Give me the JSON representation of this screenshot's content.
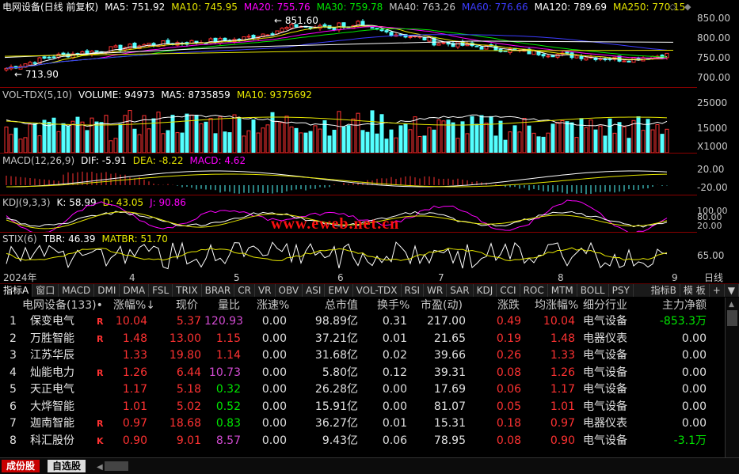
{
  "kline_header": {
    "title": "电网设备(日线 前复权)",
    "ma5": "MA5: 751.92",
    "ma10": "MA10: 745.95",
    "ma20": "MA20: 755.76",
    "ma30": "MA30: 759.78",
    "ma40": "MA40: 763.26",
    "ma60": "MA60: 776.66",
    "ma120": "MA120: 789.69",
    "ma250": "MA250: 770.15",
    "high_label": "851.60",
    "low_label": "713.90"
  },
  "kline_axis": [
    "850.00",
    "800.00",
    "750.00",
    "700.00"
  ],
  "vol_header": {
    "name": "VOL-TDX(5,10)",
    "volume": "VOLUME: 94973",
    "ma5": "MA5: 8735859",
    "ma10": "MA10: 9375692"
  },
  "vol_axis": [
    "25000",
    "15000",
    "X1000"
  ],
  "macd_header": {
    "name": "MACD(12,26,9)",
    "dif": "DIF: -5.91",
    "dea": "DEA: -8.22",
    "macd": "MACD: 4.62"
  },
  "macd_axis": [
    "20.00",
    "-20.00"
  ],
  "kdj_header": {
    "name": "KDJ(9,3,3)",
    "k": "K: 58.99",
    "d": "D: 43.05",
    "j": "J: 90.86"
  },
  "kdj_axis": [
    "100.00",
    "80.00",
    "20.00"
  ],
  "stix_header": {
    "name": "STIX(6)",
    "tbr": "TBR: 46.39",
    "matbr": "MATBR: 51.70"
  },
  "stix_axis": [
    "65.00"
  ],
  "watermark": "www.eweb.net.cn",
  "time_axis": {
    "year": "2024年",
    "months": [
      "4",
      "5",
      "6",
      "7",
      "8",
      "9"
    ],
    "period": "日线"
  },
  "indicator_tabs": [
    "指标A",
    "窗口",
    "MACD",
    "DMI",
    "DMA",
    "FSL",
    "TRIX",
    "BRAR",
    "CR",
    "VR",
    "OBV",
    "ASI",
    "EMV",
    "VOL-TDX",
    "RSI",
    "WR",
    "SAR",
    "KDJ",
    "CCI",
    "ROC",
    "MTM",
    "BOLL",
    "PSY"
  ],
  "indicator_b": "指标B",
  "template": "模 板",
  "table": {
    "headers": [
      "电网设备(133)•",
      "涨幅%↓",
      "现价",
      "量比",
      "涨速%",
      "总市值",
      "换手%",
      "市盈(动)",
      "涨跌",
      "均涨幅%",
      "细分行业",
      "主力净额"
    ],
    "rows": [
      {
        "no": "1",
        "name": "保变电气",
        "flag": "R",
        "chg": "10.04",
        "price": "5.37",
        "vr": "120.93",
        "spd": "0.00",
        "cap": "98.89亿",
        "turn": "0.31",
        "pe": "217.00",
        "diff": "0.49",
        "avg": "10.04",
        "ind": "电气设备",
        "net": "-853.3万"
      },
      {
        "no": "2",
        "name": "万胜智能",
        "flag": "R",
        "chg": "1.48",
        "price": "13.00",
        "vr": "1.15",
        "spd": "0.00",
        "cap": "37.21亿",
        "turn": "0.01",
        "pe": "21.65",
        "diff": "0.19",
        "avg": "1.48",
        "ind": "电器仪表",
        "net": "0.00"
      },
      {
        "no": "3",
        "name": "江苏华辰",
        "flag": "",
        "chg": "1.33",
        "price": "19.80",
        "vr": "1.14",
        "spd": "0.00",
        "cap": "31.68亿",
        "turn": "0.02",
        "pe": "39.66",
        "diff": "0.26",
        "avg": "1.33",
        "ind": "电气设备",
        "net": "0.00"
      },
      {
        "no": "4",
        "name": "灿能电力",
        "flag": "R",
        "chg": "1.26",
        "price": "6.44",
        "vr": "10.73",
        "spd": "0.00",
        "cap": "5.80亿",
        "turn": "0.12",
        "pe": "39.31",
        "diff": "0.08",
        "avg": "1.26",
        "ind": "电气设备",
        "net": "0.00"
      },
      {
        "no": "5",
        "name": "天正电气",
        "flag": "",
        "chg": "1.17",
        "price": "5.18",
        "vr": "0.32",
        "spd": "0.00",
        "cap": "26.28亿",
        "turn": "0.00",
        "pe": "17.69",
        "diff": "0.06",
        "avg": "1.17",
        "ind": "电气设备",
        "net": "0.00"
      },
      {
        "no": "6",
        "name": "大烨智能",
        "flag": "",
        "chg": "1.01",
        "price": "5.02",
        "vr": "0.52",
        "spd": "0.00",
        "cap": "15.91亿",
        "turn": "0.00",
        "pe": "81.07",
        "diff": "0.05",
        "avg": "1.01",
        "ind": "电气设备",
        "net": "0.00"
      },
      {
        "no": "7",
        "name": "迦南智能",
        "flag": "R",
        "chg": "0.97",
        "price": "18.68",
        "vr": "0.83",
        "spd": "0.00",
        "cap": "36.27亿",
        "turn": "0.01",
        "pe": "15.31",
        "diff": "0.18",
        "avg": "0.97",
        "ind": "电器仪表",
        "net": "0.00"
      },
      {
        "no": "8",
        "name": "科汇股份",
        "flag": "K",
        "chg": "0.90",
        "price": "9.01",
        "vr": "8.57",
        "spd": "0.00",
        "cap": "9.43亿",
        "turn": "0.06",
        "pe": "78.95",
        "diff": "0.08",
        "avg": "0.90",
        "ind": "电气设备",
        "net": "-3.1万"
      }
    ]
  },
  "bottom_tabs": [
    "成份股",
    "自选股"
  ],
  "colors": {
    "up": "#ff3232",
    "down": "#00e600",
    "stock_name": "#e6e600",
    "cyan_bar": "#54ffff",
    "red_bar": "#ff3232",
    "magenta": "#ff00ff",
    "vr_purple": "#d24bd2"
  }
}
